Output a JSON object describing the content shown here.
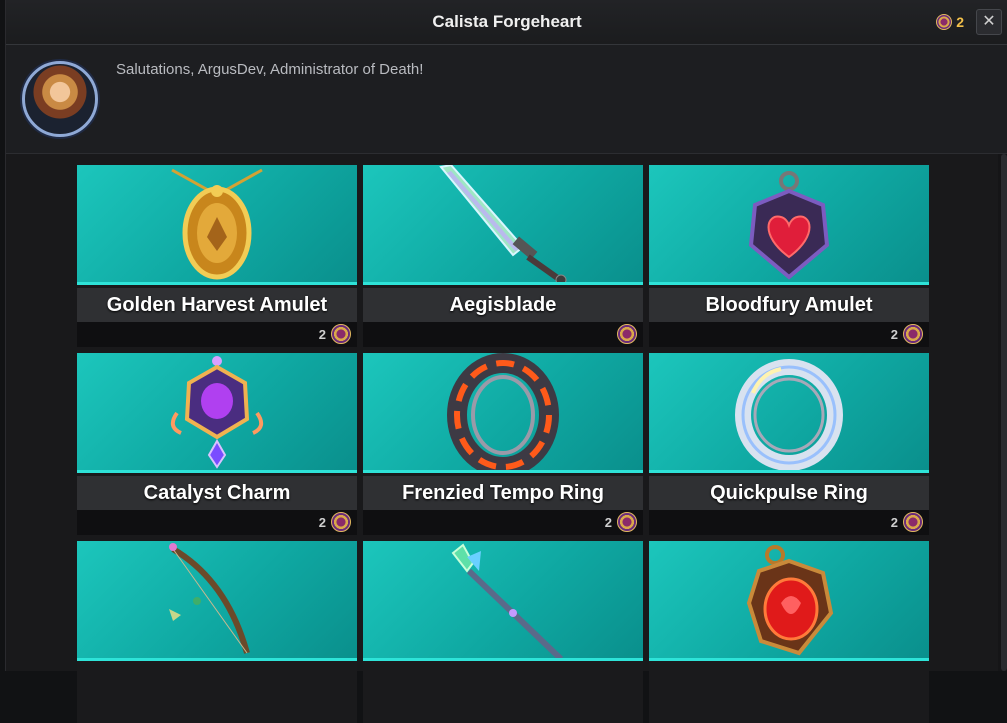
{
  "window": {
    "title": "Calista Forgeheart",
    "currency_value": "2",
    "close_label": "✕"
  },
  "npc": {
    "greeting": "Salutations, ArgusDev, Administrator of Death!"
  },
  "items": [
    {
      "name": "Golden Harvest Amulet",
      "price": "2",
      "icon": "golden-amulet-icon"
    },
    {
      "name": "Aegisblade",
      "price": "",
      "icon": "sword-icon"
    },
    {
      "name": "Bloodfury Amulet",
      "price": "2",
      "icon": "heart-amulet-icon"
    },
    {
      "name": "Catalyst Charm",
      "price": "2",
      "icon": "purple-charm-icon"
    },
    {
      "name": "Frenzied Tempo Ring",
      "price": "2",
      "icon": "lava-ring-icon"
    },
    {
      "name": "Quickpulse Ring",
      "price": "2",
      "icon": "silver-ring-icon"
    },
    {
      "name": "",
      "price": "",
      "icon": "bow-icon"
    },
    {
      "name": "",
      "price": "",
      "icon": "crystal-staff-icon"
    },
    {
      "name": "",
      "price": "",
      "icon": "red-gem-amulet-icon"
    }
  ],
  "colors": {
    "card_art": "#13b8b0",
    "accent_line": "#2ee3d8",
    "currency": "#f3c04a"
  }
}
